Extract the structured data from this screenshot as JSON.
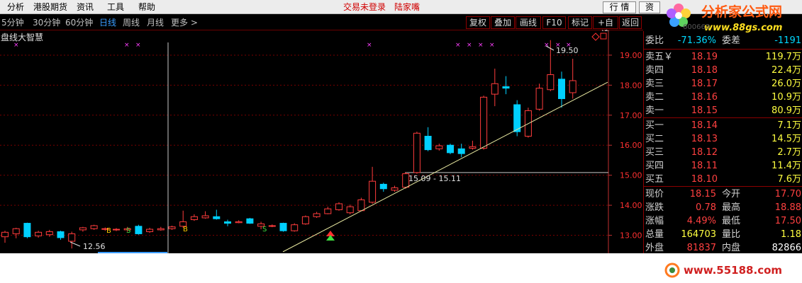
{
  "menu": [
    "分析",
    "港股期货",
    "资讯",
    "工具",
    "帮助"
  ],
  "status": {
    "login": "交易未登录",
    "name": "陆家嘴"
  },
  "tabs": {
    "quote": "行 情",
    "zi": "资"
  },
  "branding": {
    "title": "分析家公式网",
    "url": "www.88gs.com",
    "watermark": "www.55188.com",
    "faded_code": "600663",
    "faded_name": "陆家嘴"
  },
  "periods": [
    {
      "label": "5分钟",
      "active": false
    },
    {
      "label": "30分钟",
      "active": false
    },
    {
      "label": "60分钟",
      "active": false
    },
    {
      "label": "日线",
      "active": true
    },
    {
      "label": "周线",
      "active": false
    },
    {
      "label": "月线",
      "active": false
    },
    {
      "label": "更多 >",
      "active": false
    }
  ],
  "toolbar": [
    "复权",
    "叠加",
    "画线",
    "F10",
    "标记",
    "+自选",
    "返回"
  ],
  "chart_label": "盘线大智慧",
  "colors": {
    "up": "#ff3c3c",
    "down": "#00d0ff",
    "trend": "#e8e8a0",
    "grid": "#7a0000",
    "axis": "#c03030",
    "marker": "#ff40ff",
    "price_text": "#ff3030"
  },
  "chart_data": {
    "type": "candlestick",
    "y_ticks": [
      13.0,
      14.0,
      15.0,
      16.0,
      17.0,
      18.0,
      19.0
    ],
    "ylim": [
      12.4,
      19.8
    ],
    "annotations": {
      "high_label": "19.50",
      "low_label": "12.56",
      "range_label": "15.09 - 15.11"
    },
    "candles": [
      {
        "o": 12.95,
        "c": 13.1,
        "h": 13.15,
        "l": 12.75
      },
      {
        "o": 13.05,
        "c": 13.22,
        "h": 13.25,
        "l": 12.9
      },
      {
        "o": 13.4,
        "c": 12.95,
        "h": 13.42,
        "l": 12.9
      },
      {
        "o": 12.98,
        "c": 13.1,
        "h": 13.15,
        "l": 12.92
      },
      {
        "o": 13.02,
        "c": 13.12,
        "h": 13.18,
        "l": 12.95
      },
      {
        "o": 13.12,
        "c": 12.92,
        "h": 13.15,
        "l": 12.85
      },
      {
        "o": 12.8,
        "c": 13.05,
        "h": 13.12,
        "l": 12.56
      },
      {
        "o": 13.18,
        "c": 13.25,
        "h": 13.28,
        "l": 13.12
      },
      {
        "o": 13.22,
        "c": 13.32,
        "h": 13.35,
        "l": 13.18
      },
      {
        "o": 13.2,
        "c": 13.22,
        "h": 13.26,
        "l": 13.15
      },
      {
        "o": 13.18,
        "c": 13.2,
        "h": 13.24,
        "l": 13.14
      },
      {
        "o": 13.18,
        "c": 13.22,
        "h": 13.28,
        "l": 13.12
      },
      {
        "o": 13.3,
        "c": 13.05,
        "h": 13.35,
        "l": 13.02
      },
      {
        "o": 13.12,
        "c": 13.2,
        "h": 13.25,
        "l": 13.08
      },
      {
        "o": 13.18,
        "c": 13.22,
        "h": 13.28,
        "l": 13.15
      },
      {
        "o": 13.22,
        "c": 13.28,
        "h": 13.32,
        "l": 13.18
      },
      {
        "o": 13.3,
        "c": 13.45,
        "h": 13.82,
        "l": 13.25
      },
      {
        "o": 13.52,
        "c": 13.62,
        "h": 13.7,
        "l": 13.48
      },
      {
        "o": 13.58,
        "c": 13.65,
        "h": 13.8,
        "l": 13.55
      },
      {
        "o": 13.62,
        "c": 13.55,
        "h": 13.85,
        "l": 13.52
      },
      {
        "o": 13.45,
        "c": 13.4,
        "h": 13.52,
        "l": 13.3
      },
      {
        "o": 13.42,
        "c": 13.45,
        "h": 13.5,
        "l": 13.4
      },
      {
        "o": 13.55,
        "c": 13.4,
        "h": 13.58,
        "l": 13.38
      },
      {
        "o": 13.3,
        "c": 13.38,
        "h": 13.45,
        "l": 13.2
      },
      {
        "o": 13.3,
        "c": 13.32,
        "h": 13.36,
        "l": 13.27
      },
      {
        "o": 13.4,
        "c": 13.15,
        "h": 13.42,
        "l": 13.12
      },
      {
        "o": 13.15,
        "c": 13.35,
        "h": 13.4,
        "l": 13.12
      },
      {
        "o": 13.38,
        "c": 13.62,
        "h": 13.66,
        "l": 13.35
      },
      {
        "o": 13.62,
        "c": 13.72,
        "h": 13.78,
        "l": 13.58
      },
      {
        "o": 13.72,
        "c": 13.88,
        "h": 13.95,
        "l": 13.7
      },
      {
        "o": 13.85,
        "c": 14.05,
        "h": 14.1,
        "l": 13.82
      },
      {
        "o": 13.75,
        "c": 13.95,
        "h": 14.02,
        "l": 13.7
      },
      {
        "o": 13.82,
        "c": 14.18,
        "h": 14.25,
        "l": 13.8
      },
      {
        "o": 14.1,
        "c": 14.8,
        "h": 15.28,
        "l": 14.05
      },
      {
        "o": 14.7,
        "c": 14.55,
        "h": 14.75,
        "l": 14.45
      },
      {
        "o": 14.5,
        "c": 14.58,
        "h": 14.65,
        "l": 14.45
      },
      {
        "o": 14.6,
        "c": 15.05,
        "h": 15.1,
        "l": 14.55
      },
      {
        "o": 15.09,
        "c": 16.4,
        "h": 16.45,
        "l": 15.05
      },
      {
        "o": 16.3,
        "c": 15.85,
        "h": 16.6,
        "l": 15.8
      },
      {
        "o": 15.88,
        "c": 15.98,
        "h": 16.05,
        "l": 15.82
      },
      {
        "o": 16.0,
        "c": 15.75,
        "h": 16.05,
        "l": 15.7
      },
      {
        "o": 15.88,
        "c": 15.72,
        "h": 16.05,
        "l": 15.6
      },
      {
        "o": 15.9,
        "c": 15.95,
        "h": 16.15,
        "l": 15.85
      },
      {
        "o": 15.9,
        "c": 17.6,
        "h": 17.65,
        "l": 15.85
      },
      {
        "o": 17.7,
        "c": 18.05,
        "h": 18.55,
        "l": 17.3
      },
      {
        "o": 17.95,
        "c": 17.9,
        "h": 18.3,
        "l": 17.7
      },
      {
        "o": 17.35,
        "c": 16.45,
        "h": 17.5,
        "l": 16.3
      },
      {
        "o": 16.3,
        "c": 17.15,
        "h": 17.25,
        "l": 16.25
      },
      {
        "o": 17.2,
        "c": 17.9,
        "h": 18.05,
        "l": 17.15
      },
      {
        "o": 17.85,
        "c": 18.35,
        "h": 19.5,
        "l": 17.8
      },
      {
        "o": 18.2,
        "c": 17.55,
        "h": 18.45,
        "l": 17.25
      },
      {
        "o": 17.75,
        "c": 18.15,
        "h": 18.88,
        "l": 17.55
      }
    ]
  },
  "orderbook": {
    "committee": {
      "label": "委比",
      "value": "-71.36%",
      "label2": "委差",
      "value2": "-1191"
    },
    "asks": [
      {
        "label": "卖五￥",
        "price": "18.19",
        "vol": "119.7万"
      },
      {
        "label": "卖四",
        "price": "18.18",
        "vol": "22.4万"
      },
      {
        "label": "卖三",
        "price": "18.17",
        "vol": "26.0万"
      },
      {
        "label": "卖二",
        "price": "18.16",
        "vol": "10.9万"
      },
      {
        "label": "卖一",
        "price": "18.15",
        "vol": "80.9万"
      }
    ],
    "bids": [
      {
        "label": "买一",
        "price": "18.14",
        "vol": "7.1万"
      },
      {
        "label": "买二",
        "price": "18.13",
        "vol": "14.5万"
      },
      {
        "label": "买三",
        "price": "18.12",
        "vol": "2.7万"
      },
      {
        "label": "买四",
        "price": "18.11",
        "vol": "11.4万"
      },
      {
        "label": "买五",
        "price": "18.10",
        "vol": "7.6万"
      }
    ],
    "stats": [
      {
        "l1": "现价",
        "v1": "18.15",
        "l2": "今开",
        "v2": "17.70"
      },
      {
        "l1": "涨跌",
        "v1": "0.78",
        "l2": "最高",
        "v2": "18.88"
      },
      {
        "l1": "涨幅",
        "v1": "4.49%",
        "l2": "最低",
        "v2": "17.50"
      },
      {
        "l1": "总量",
        "v1": "164703",
        "l2": "量比",
        "v2": "1.18"
      },
      {
        "l1": "外盘",
        "v1": "81837",
        "l2": "内盘",
        "v2": "82866"
      }
    ]
  }
}
